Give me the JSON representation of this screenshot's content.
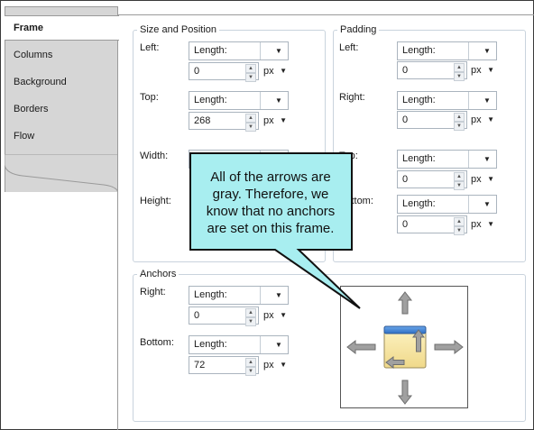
{
  "nav": {
    "items": [
      {
        "label": "Frame"
      },
      {
        "label": "Columns"
      },
      {
        "label": "Background"
      },
      {
        "label": "Borders"
      },
      {
        "label": "Flow"
      }
    ]
  },
  "size_position": {
    "title": "Size and Position",
    "left": {
      "label": "Left:",
      "mode": "Length:",
      "value": "0",
      "unit": "px"
    },
    "top": {
      "label": "Top:",
      "mode": "Length:",
      "value": "268",
      "unit": "px"
    },
    "width": {
      "label": "Width:"
    },
    "height": {
      "label": "Height:"
    }
  },
  "padding": {
    "title": "Padding",
    "left": {
      "label": "Left:",
      "mode": "Length:",
      "value": "0",
      "unit": "px"
    },
    "right": {
      "label": "Right:",
      "mode": "Length:",
      "value": "0",
      "unit": "px"
    },
    "top": {
      "label": "Top:",
      "mode": "Length:",
      "value": "0",
      "unit": "px"
    },
    "bottom": {
      "label": "Bottom:",
      "mode": "Length:",
      "value": "0",
      "unit": "px"
    }
  },
  "anchors": {
    "title": "Anchors",
    "right": {
      "label": "Right:",
      "mode": "Length:",
      "value": "0",
      "unit": "px"
    },
    "bottom": {
      "label": "Bottom:",
      "mode": "Length:",
      "value": "72",
      "unit": "px"
    }
  },
  "callout": {
    "text": "All of the arrows are gray. Therefore, we know that no anchors are set on this frame."
  },
  "colors": {
    "callout_fill": "#a8eef0",
    "arrow_gray": "#9c9c9c",
    "frame_header_blue": "#3a7fd0",
    "frame_body": "#f6e6a6"
  }
}
